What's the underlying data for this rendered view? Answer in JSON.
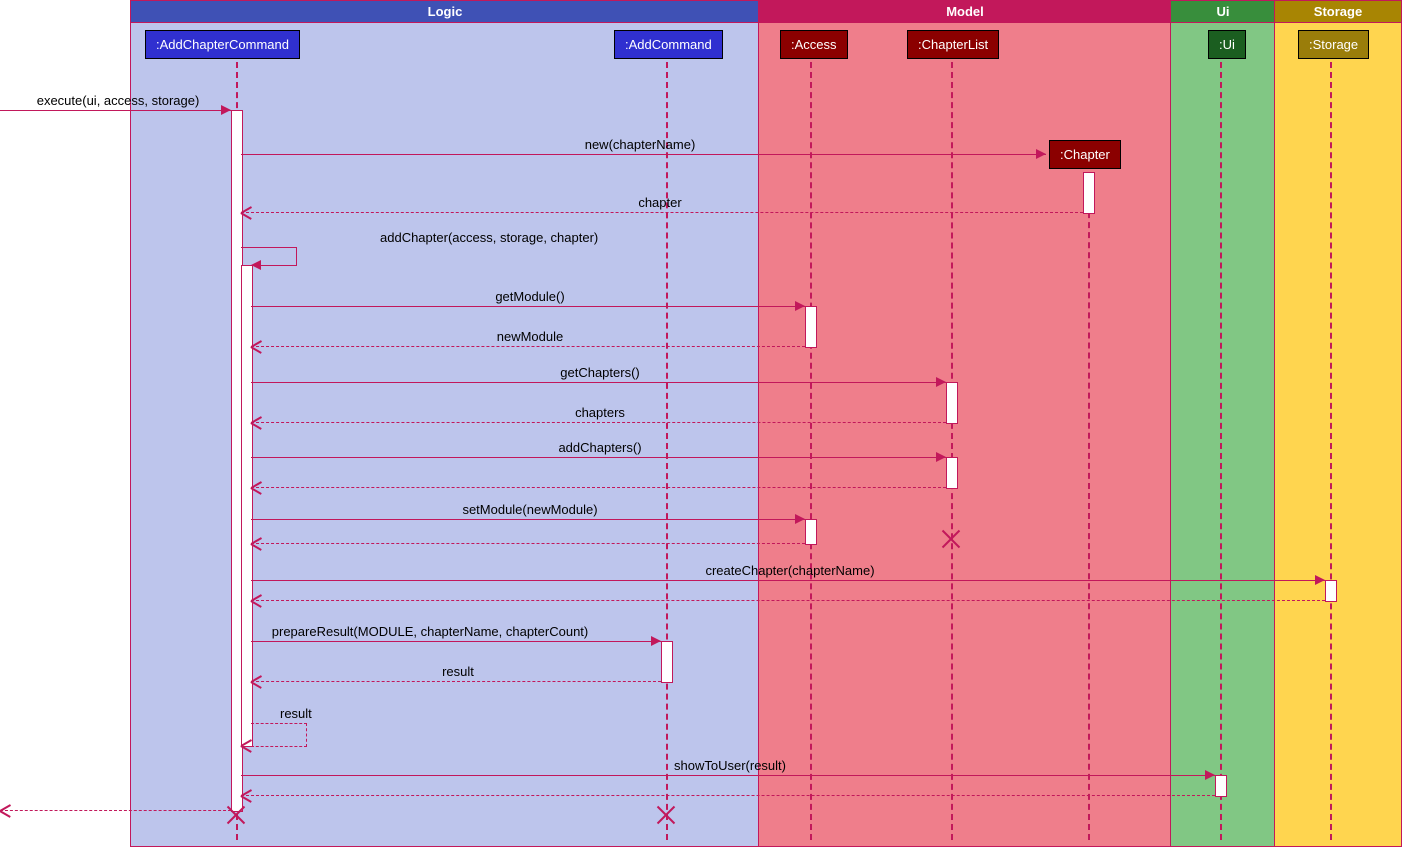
{
  "regions": {
    "logic": "Logic",
    "model": "Model",
    "ui": "Ui",
    "storage": "Storage"
  },
  "participants": {
    "addChapterCommand": ":AddChapterCommand",
    "addCommand": ":AddCommand",
    "access": ":Access",
    "chapterList": ":ChapterList",
    "chapter": ":Chapter",
    "ui": ":Ui",
    "storage": ":Storage"
  },
  "messages": {
    "execute": "execute(ui, access, storage)",
    "newChapter": "new(chapterName)",
    "chapterReturn": "chapter",
    "addChapter": "addChapter(access, storage, chapter)",
    "getModule": "getModule()",
    "newModule": "newModule",
    "getChapters": "getChapters()",
    "chapters": "chapters",
    "addChapters": "addChapters()",
    "setModule": "setModule(newModule)",
    "createChapter": "createChapter(chapterName)",
    "prepareResult": "prepareResult(MODULE, chapterName, chapterCount)",
    "result": "result",
    "showToUser": "showToUser(result)"
  },
  "chart_data": {
    "type": "sequence_diagram",
    "partitions": [
      {
        "name": "Logic",
        "participants": [
          "AddChapterCommand",
          "AddCommand"
        ]
      },
      {
        "name": "Model",
        "participants": [
          "Access",
          "ChapterList",
          "Chapter"
        ]
      },
      {
        "name": "Ui",
        "participants": [
          "Ui"
        ]
      },
      {
        "name": "Storage",
        "participants": [
          "Storage"
        ]
      }
    ],
    "interactions": [
      {
        "from": "external",
        "to": "AddChapterCommand",
        "label": "execute(ui, access, storage)",
        "type": "sync"
      },
      {
        "from": "AddChapterCommand",
        "to": "Chapter",
        "label": "new(chapterName)",
        "type": "create"
      },
      {
        "from": "Chapter",
        "to": "AddChapterCommand",
        "label": "chapter",
        "type": "return"
      },
      {
        "from": "AddChapterCommand",
        "to": "AddChapterCommand",
        "label": "addChapter(access, storage, chapter)",
        "type": "self"
      },
      {
        "from": "AddChapterCommand",
        "to": "Access",
        "label": "getModule()",
        "type": "sync"
      },
      {
        "from": "Access",
        "to": "AddChapterCommand",
        "label": "newModule",
        "type": "return"
      },
      {
        "from": "AddChapterCommand",
        "to": "ChapterList",
        "label": "getChapters()",
        "type": "sync"
      },
      {
        "from": "ChapterList",
        "to": "AddChapterCommand",
        "label": "chapters",
        "type": "return"
      },
      {
        "from": "AddChapterCommand",
        "to": "ChapterList",
        "label": "addChapters()",
        "type": "sync"
      },
      {
        "from": "ChapterList",
        "to": "AddChapterCommand",
        "label": "",
        "type": "return"
      },
      {
        "from": "AddChapterCommand",
        "to": "Access",
        "label": "setModule(newModule)",
        "type": "sync"
      },
      {
        "from": "Access",
        "to": "AddChapterCommand",
        "label": "",
        "type": "return"
      },
      {
        "from": "ChapterList",
        "type": "destroy"
      },
      {
        "from": "AddChapterCommand",
        "to": "Storage",
        "label": "createChapter(chapterName)",
        "type": "sync"
      },
      {
        "from": "Storage",
        "to": "AddChapterCommand",
        "label": "",
        "type": "return"
      },
      {
        "from": "AddChapterCommand",
        "to": "AddCommand",
        "label": "prepareResult(MODULE, chapterName, chapterCount)",
        "type": "sync"
      },
      {
        "from": "AddCommand",
        "to": "AddChapterCommand",
        "label": "result",
        "type": "return"
      },
      {
        "from": "AddChapterCommand",
        "to": "AddChapterCommand",
        "label": "result",
        "type": "self-return"
      },
      {
        "from": "AddChapterCommand",
        "to": "Ui",
        "label": "showToUser(result)",
        "type": "sync"
      },
      {
        "from": "Ui",
        "to": "AddChapterCommand",
        "label": "",
        "type": "return"
      },
      {
        "from": "AddChapterCommand",
        "to": "external",
        "label": "",
        "type": "return"
      },
      {
        "from": "AddChapterCommand",
        "type": "destroy"
      },
      {
        "from": "AddCommand",
        "type": "destroy"
      }
    ]
  }
}
